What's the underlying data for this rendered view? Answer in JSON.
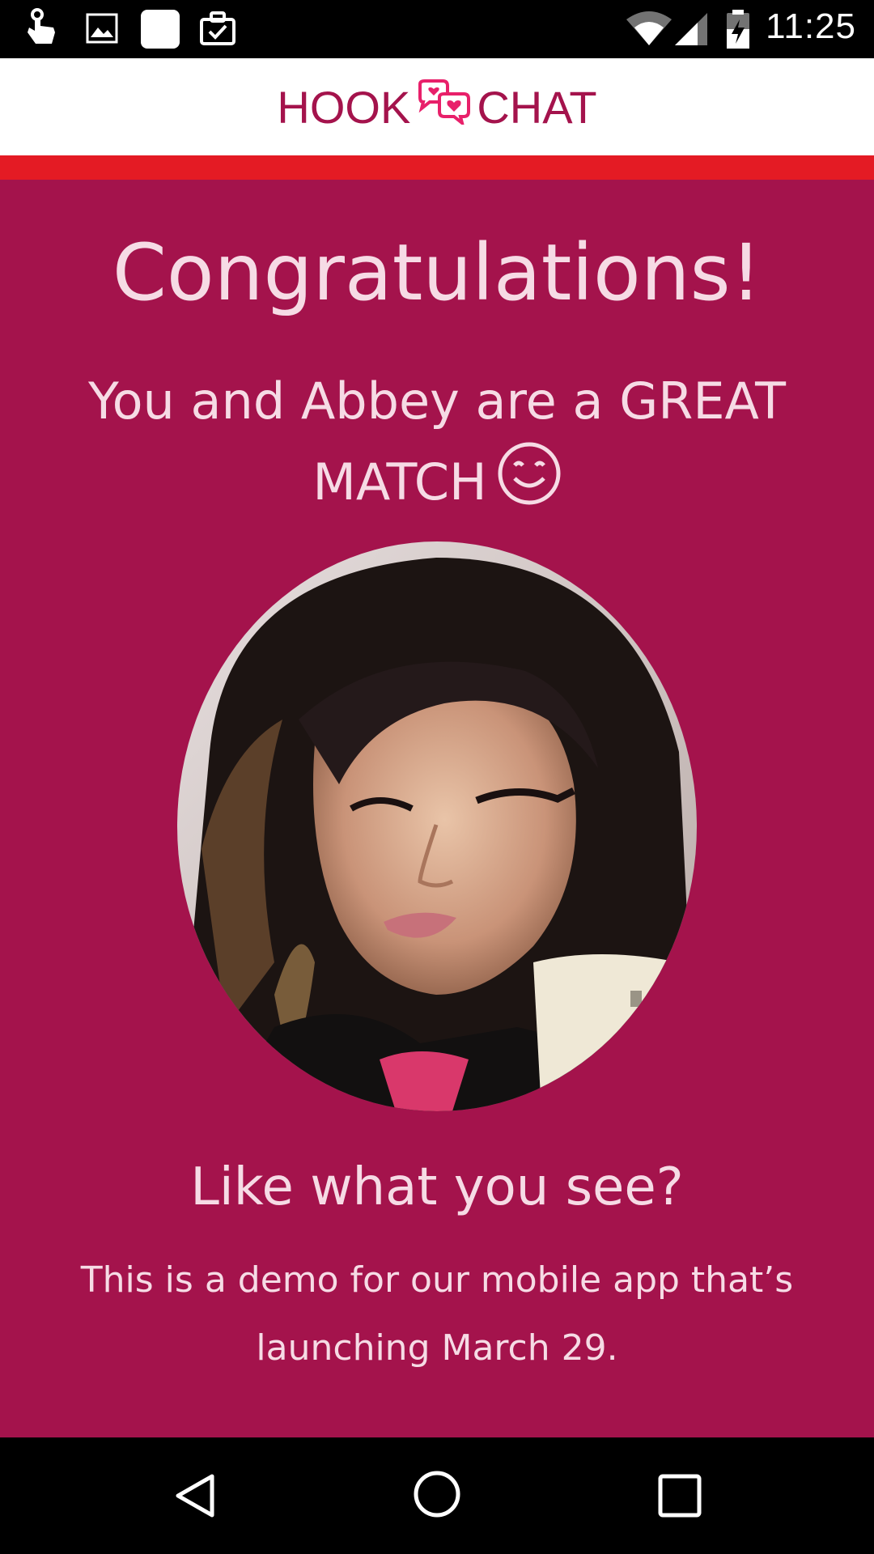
{
  "status_bar": {
    "time": "11:25",
    "icons": [
      "touch-notification-icon",
      "image-notification-icon",
      "app-notification-icon",
      "task-notification-icon",
      "wifi-icon",
      "cell-signal-icon",
      "battery-charging-icon"
    ]
  },
  "header": {
    "brand_left": "HOOK",
    "brand_right": "CHAT",
    "logo": "chat-bubbles-heart-icon"
  },
  "colors": {
    "primary": "#a4134c",
    "accent_bar": "#e41b24",
    "text_light": "#f6dbe5"
  },
  "main": {
    "title": "Congratulations!",
    "match_text": "You and Abbey are a GREAT MATCH",
    "smiley": "smiley-icon",
    "photo": "profile-photo-abbey",
    "question": "Like what you see?",
    "demo_text": "This is a demo for our mobile app that’s launching March 29."
  },
  "nav_bar": {
    "buttons": [
      "back-icon",
      "home-icon",
      "recents-icon"
    ]
  }
}
